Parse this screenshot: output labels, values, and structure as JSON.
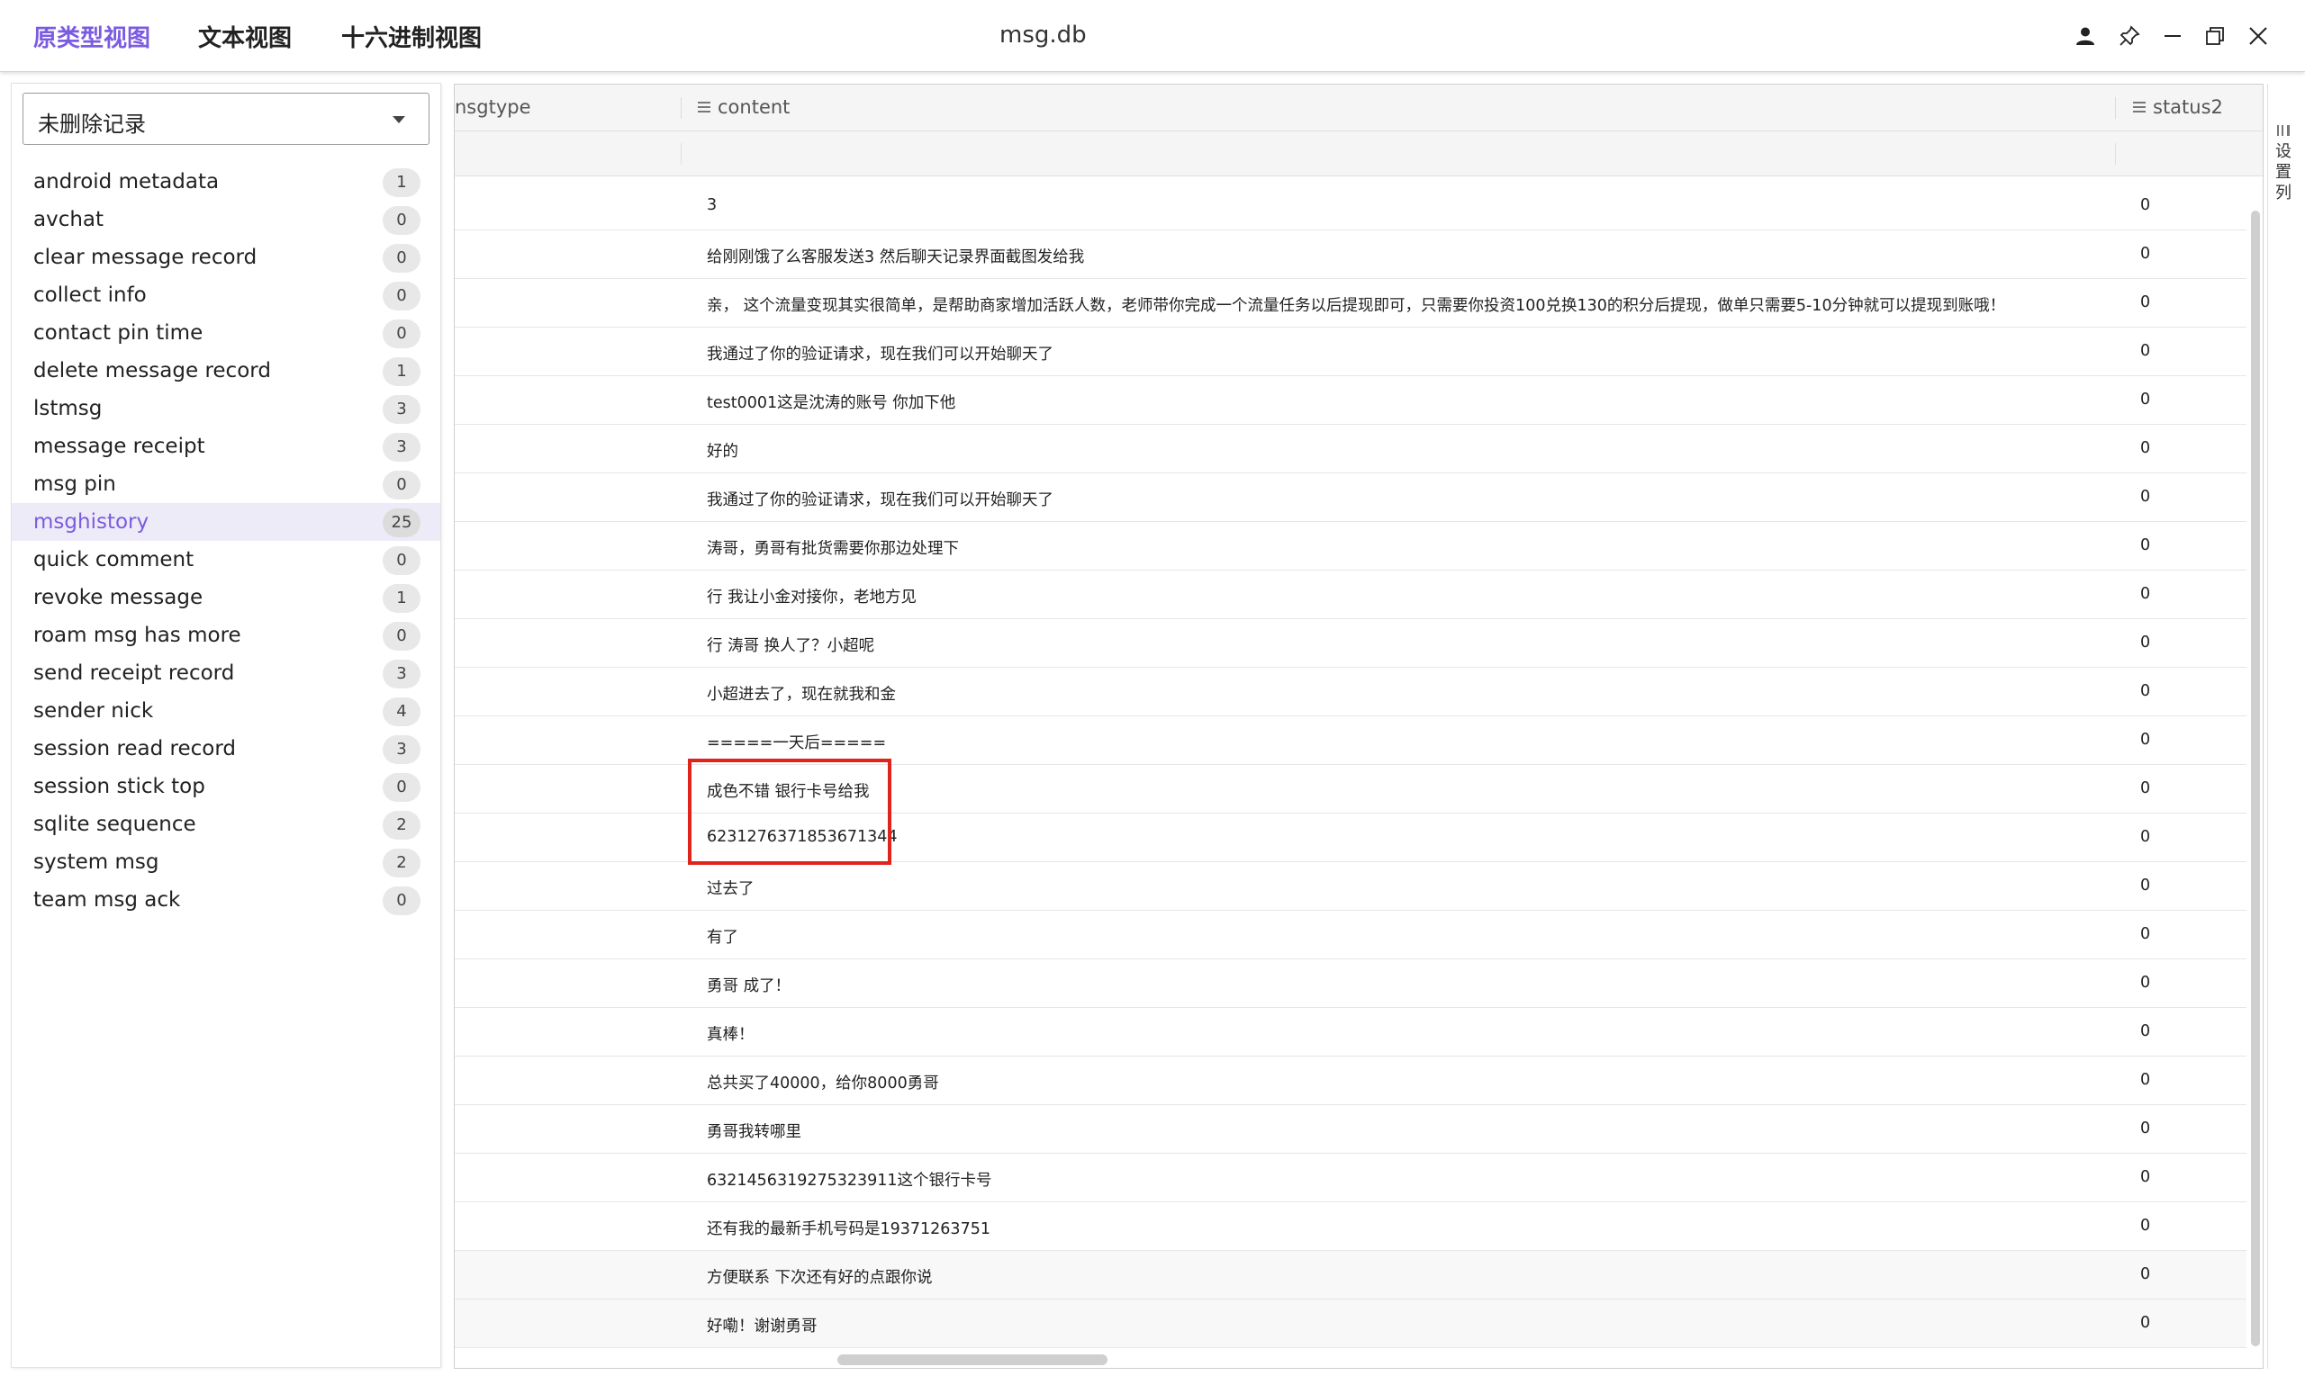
{
  "header": {
    "tabs": [
      {
        "label": "原类型视图"
      },
      {
        "label": "文本视图"
      },
      {
        "label": "十六进制视图"
      }
    ],
    "title": "msg.db"
  },
  "sidebar": {
    "filter_select": "未删除记录",
    "tables": [
      {
        "name": "android metadata",
        "count": "1"
      },
      {
        "name": "avchat",
        "count": "0"
      },
      {
        "name": "clear message record",
        "count": "0"
      },
      {
        "name": "collect info",
        "count": "0"
      },
      {
        "name": "contact pin time",
        "count": "0"
      },
      {
        "name": "delete message record",
        "count": "1"
      },
      {
        "name": "lstmsg",
        "count": "3"
      },
      {
        "name": "message receipt",
        "count": "3"
      },
      {
        "name": "msg pin",
        "count": "0"
      },
      {
        "name": "msghistory",
        "count": "25"
      },
      {
        "name": "quick comment",
        "count": "0"
      },
      {
        "name": "revoke message",
        "count": "1"
      },
      {
        "name": "roam msg has more",
        "count": "0"
      },
      {
        "name": "send receipt record",
        "count": "3"
      },
      {
        "name": "sender nick",
        "count": "4"
      },
      {
        "name": "session read record",
        "count": "3"
      },
      {
        "name": "session stick top",
        "count": "0"
      },
      {
        "name": "sqlite sequence",
        "count": "2"
      },
      {
        "name": "system msg",
        "count": "2"
      },
      {
        "name": "team msg ack",
        "count": "0"
      }
    ]
  },
  "grid": {
    "columns": {
      "msgtype": "nsgtype",
      "content": "content",
      "status2": "status2"
    },
    "rows": [
      {
        "content": "3",
        "status2": "0"
      },
      {
        "content": "给刚刚饿了么客服发送3 然后聊天记录界面截图发给我",
        "status2": "0"
      },
      {
        "content": "亲， 这个流量变现其实很简单，是帮助商家增加活跃人数，老师带你完成一个流量任务以后提现即可，只需要你投资100兑换130的积分后提现，做单只需要5-10分钟就可以提现到账哦！",
        "status2": "0"
      },
      {
        "content": "我通过了你的验证请求，现在我们可以开始聊天了",
        "status2": "0"
      },
      {
        "content": "test0001这是沈涛的账号 你加下他",
        "status2": "0"
      },
      {
        "content": "好的",
        "status2": "0"
      },
      {
        "content": "我通过了你的验证请求，现在我们可以开始聊天了",
        "status2": "0"
      },
      {
        "content": "涛哥，勇哥有批货需要你那边处理下",
        "status2": "0"
      },
      {
        "content": "行 我让小金对接你，老地方见",
        "status2": "0"
      },
      {
        "content": "行 涛哥 换人了？小超呢",
        "status2": "0"
      },
      {
        "content": "小超进去了，现在就我和金",
        "status2": "0"
      },
      {
        "content": "=====一天后=====",
        "status2": "0"
      },
      {
        "content": "成色不错 银行卡号给我",
        "status2": "0"
      },
      {
        "content": "6231276371853671344",
        "status2": "0"
      },
      {
        "content": "过去了",
        "status2": "0"
      },
      {
        "content": "有了",
        "status2": "0"
      },
      {
        "content": "勇哥 成了！",
        "status2": "0"
      },
      {
        "content": "真棒！",
        "status2": "0"
      },
      {
        "content": "总共买了40000，给你8000勇哥",
        "status2": "0"
      },
      {
        "content": "勇哥我转哪里",
        "status2": "0"
      },
      {
        "content": "6321456319275323911这个银行卡号",
        "status2": "0"
      },
      {
        "content": "还有我的最新手机号码是19371263751",
        "status2": "0"
      },
      {
        "content": "方便联系 下次还有好的点跟你说",
        "status2": "0"
      },
      {
        "content": "好嘞！谢谢勇哥",
        "status2": "0"
      }
    ]
  },
  "settings_strip": {
    "label": "设置列"
  },
  "colors": {
    "accent": "#7b5be0",
    "highlight_box": "#e0231b"
  }
}
